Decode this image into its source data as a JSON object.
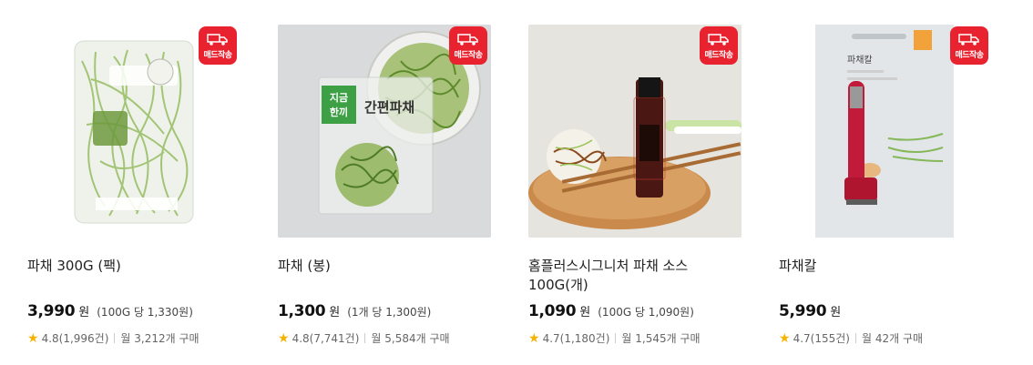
{
  "badge": {
    "label": "매드작송",
    "color": "#e8222f",
    "icon": "truck-icon"
  },
  "products": [
    {
      "name": "파채 300G (팩)",
      "price": "3,990",
      "won": "원",
      "unit_price": "(100G 당 1,330원)",
      "rating": "4.8(1,996건)",
      "monthly": "월 3,212개 구매"
    },
    {
      "name": "파채 (봉)",
      "price": "1,300",
      "won": "원",
      "unit_price": "(1개 당 1,300원)",
      "rating": "4.8(7,741건)",
      "monthly": "월 5,584개 구매"
    },
    {
      "name": "홈플러스시그니처 파채 소스 100G(개)",
      "price": "1,090",
      "won": "원",
      "unit_price": "(100G 당 1,090원)",
      "rating": "4.7(1,180건)",
      "monthly": "월 1,545개 구매"
    },
    {
      "name": "파채칼",
      "price": "5,990",
      "won": "원",
      "unit_price": "",
      "rating": "4.7(155건)",
      "monthly": "월 42개 구매"
    }
  ],
  "image_text": {
    "bag_green": "지금\n한끼",
    "bag_title": "간편파채",
    "knife_pkg": "파채칼"
  }
}
